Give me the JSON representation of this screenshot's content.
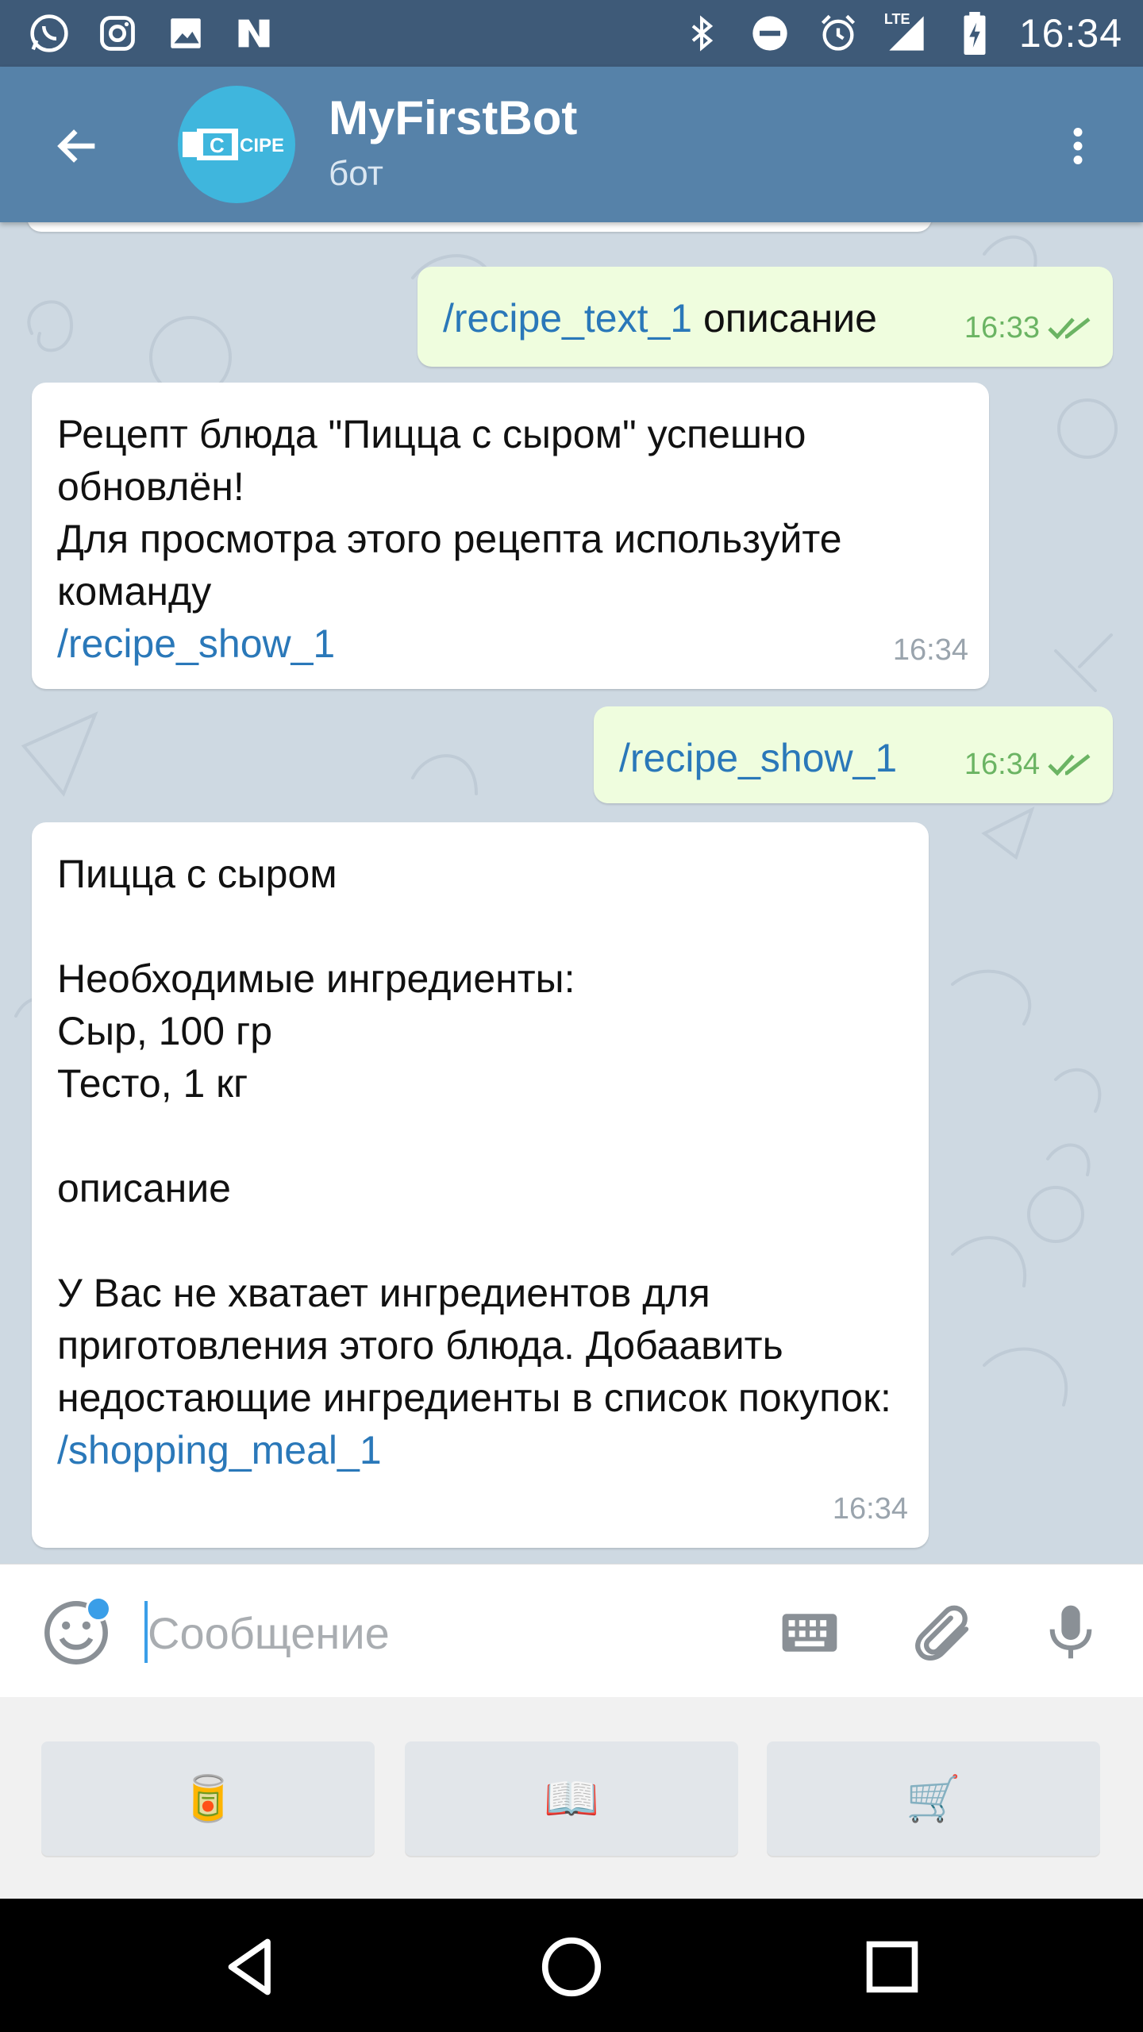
{
  "status_bar": {
    "time": "16:34",
    "network": "LTE",
    "left_icons": [
      "whatsapp-icon",
      "instagram-icon",
      "gallery-icon",
      "n-app-icon"
    ],
    "right_icons": [
      "bluetooth-icon",
      "do-not-disturb-icon",
      "alarm-icon",
      "signal-icon",
      "battery-icon"
    ]
  },
  "header": {
    "title": "MyFirstBot",
    "subtitle": "бот",
    "avatar_text": "CIPE"
  },
  "messages": [
    {
      "direction": "out",
      "parts": [
        {
          "text": "/recipe_text_1",
          "command": true
        },
        {
          "text": " описание",
          "command": false
        }
      ],
      "time": "16:33",
      "status": "read"
    },
    {
      "direction": "in",
      "parts": [
        {
          "text": "Рецепт блюда \"Пицца с сыром\" успешно обновлён!\nДля просмотра этого рецепта используйте команду\n",
          "command": false
        },
        {
          "text": "/recipe_show_1",
          "command": true
        }
      ],
      "time": "16:34"
    },
    {
      "direction": "out",
      "parts": [
        {
          "text": "/recipe_show_1",
          "command": true
        }
      ],
      "time": "16:34",
      "status": "read"
    },
    {
      "direction": "in",
      "parts": [
        {
          "text": "Пицца с сыром\n\nНеобходимые ингредиенты:\nСыр, 100 гр\nТесто, 1 кг\n\nописание\n\nУ Вас не хватает ингредиентов для приготовления этого блюда. Добаавить недостающие ингредиенты в список покупок:\n",
          "command": false
        },
        {
          "text": "/shopping_meal_1",
          "command": true
        }
      ],
      "time": "16:34"
    }
  ],
  "composer": {
    "placeholder": "Сообщение",
    "value": ""
  },
  "bot_keyboard": [
    {
      "label": "🥫",
      "icon": "canned-food-icon"
    },
    {
      "label": "📖",
      "icon": "open-book-icon"
    },
    {
      "label": "🛒",
      "icon": "shopping-cart-icon"
    }
  ],
  "nav_bar": [
    "back-triangle-icon",
    "home-circle-icon",
    "recents-square-icon"
  ],
  "colors": {
    "status_bar": "#3e5a78",
    "app_bar": "#5682a9",
    "chat_background": "#ced9e2",
    "outgoing_bubble": "#effdde",
    "incoming_bubble": "#ffffff",
    "command_link": "#2a78b9",
    "outgoing_meta": "#6bb463"
  }
}
